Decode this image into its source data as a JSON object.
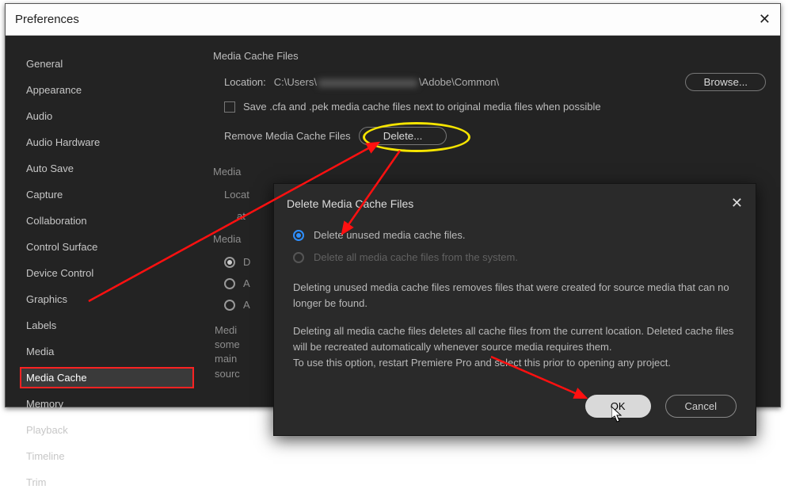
{
  "prefs": {
    "title": "Preferences",
    "sidebar": {
      "items": [
        {
          "label": "General"
        },
        {
          "label": "Appearance"
        },
        {
          "label": "Audio"
        },
        {
          "label": "Audio Hardware"
        },
        {
          "label": "Auto Save"
        },
        {
          "label": "Capture"
        },
        {
          "label": "Collaboration"
        },
        {
          "label": "Control Surface"
        },
        {
          "label": "Device Control"
        },
        {
          "label": "Graphics"
        },
        {
          "label": "Labels"
        },
        {
          "label": "Media"
        },
        {
          "label": "Media Cache",
          "selected": true,
          "highlighted": true
        },
        {
          "label": "Memory"
        },
        {
          "label": "Playback"
        },
        {
          "label": "Timeline"
        },
        {
          "label": "Trim"
        }
      ]
    },
    "section1_title": "Media Cache Files",
    "location_label": "Location:",
    "location_prefix": "C:\\Users\\",
    "location_suffix": "\\Adobe\\Common\\",
    "browse_btn": "Browse...",
    "save_checkbox_label": "Save .cfa and .pek media cache files next to original media files when possible",
    "remove_label": "Remove Media Cache Files",
    "delete_btn": "Delete...",
    "section2_prefix": "Media",
    "locat_row": "Locat",
    "at_row": "at",
    "section3_prefix": "Media",
    "radio_d": "D",
    "radio_a1": "A",
    "radio_a2": "A",
    "body_text_1": "Medi",
    "body_text_2": "some",
    "body_text_3": "main",
    "body_text_4": "sourc"
  },
  "dialog": {
    "title": "Delete Media Cache Files",
    "option1": "Delete unused media cache files.",
    "option2": "Delete all media cache files from the system.",
    "para1": "Deleting unused media cache files removes files that were created for source media that can no longer be found.",
    "para2": "Deleting all media cache files deletes all cache files from the current location. Deleted cache files will be recreated automatically whenever source media requires them.",
    "para3": "To use this option, restart Premiere Pro and select this prior to opening any project.",
    "ok": "OK",
    "cancel": "Cancel"
  }
}
